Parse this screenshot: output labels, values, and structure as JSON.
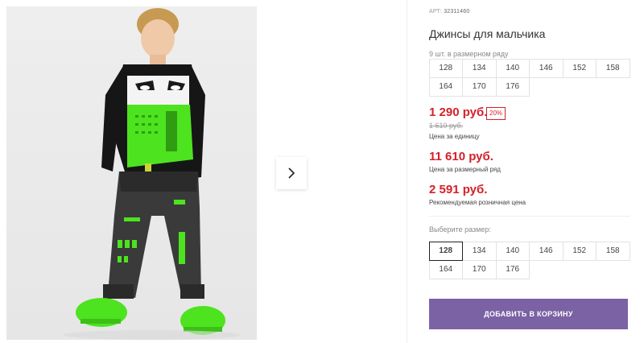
{
  "product": {
    "article_label": "АРТ:",
    "article_value": "32311460",
    "title": "Джинсы для мальчика",
    "set_note": "9 шт. в размерном ряду"
  },
  "size_set": [
    "128",
    "134",
    "140",
    "146",
    "152",
    "158",
    "164",
    "170",
    "176"
  ],
  "prices": {
    "unit_price": "1 290 руб.",
    "discount": "20%",
    "old_price": "1 610 руб.",
    "unit_note": "Цена за единицу",
    "set_price": "11 610 руб.",
    "set_note": "Цена за размерный ряд",
    "rrp_price": "2 591 руб.",
    "rrp_note": "Рекомендуемая розничная цена"
  },
  "size_picker": {
    "label": "Выберите размер:",
    "selected": "128",
    "sizes": [
      "128",
      "134",
      "140",
      "146",
      "152",
      "158",
      "164",
      "170",
      "176"
    ]
  },
  "cart": {
    "add_label": "ДОБАВИТЬ В КОРЗИНУ"
  },
  "gallery": {
    "next_icon": "chevron-right-icon"
  },
  "colors": {
    "accent": "#7a62a4",
    "price": "#d4202a",
    "neon": "#4de31f"
  }
}
